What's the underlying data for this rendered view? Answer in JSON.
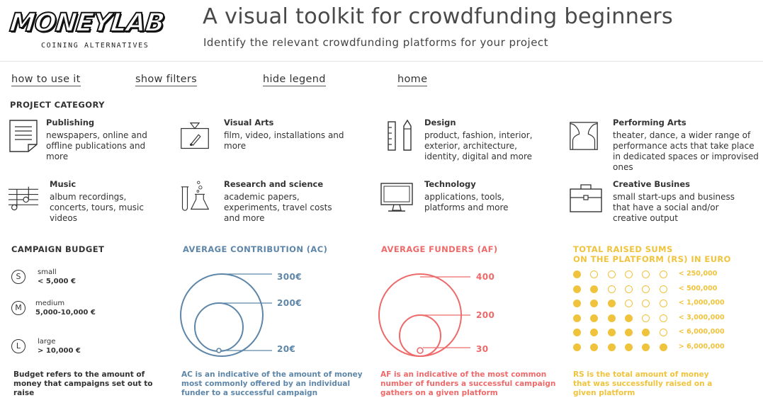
{
  "header": {
    "logo_text": "MONEYLAB",
    "logo_tagline": "COINING ALTERNATIVES",
    "title": "A visual toolkit for crowdfunding beginners",
    "subtitle": "Identify the relevant crowdfunding platforms for your project"
  },
  "nav": {
    "how_to_use": "how to use it",
    "show_filters": "show filters",
    "hide_legend": "hide legend",
    "home": "home"
  },
  "category": {
    "heading": "PROJECT CATEGORY",
    "items": [
      {
        "title": "Publishing",
        "desc": "newspapers, online and offline publications and more",
        "icon": "document-icon"
      },
      {
        "title": "Visual Arts",
        "desc": "film, video, installations and more",
        "icon": "easel-brush-icon"
      },
      {
        "title": "Design",
        "desc": "product, fashion, interior, exterior, architecture, identity, digital and more",
        "icon": "ruler-pencil-icon"
      },
      {
        "title": "Performing Arts",
        "desc": "theater, dance, a wider range of performance acts that take place in dedicated spaces or improvised ones",
        "icon": "stage-curtain-icon"
      },
      {
        "title": "Music",
        "desc": "album recordings, concerts, tours, music videos",
        "icon": "music-staff-icon"
      },
      {
        "title": "Research and science",
        "desc": "academic papers, experiments, travel costs and more",
        "icon": "flask-test-tube-icon"
      },
      {
        "title": "Technology",
        "desc": "applications, tools, platforms and more",
        "icon": "monitor-icon"
      },
      {
        "title": "Creative Busines",
        "desc": "small start-ups and business that have a social and/or creative output",
        "icon": "briefcase-icon"
      }
    ]
  },
  "budget": {
    "heading": "CAMPAIGN BUDGET",
    "items": [
      {
        "letter": "S",
        "size": "small",
        "range": "< 5,000 €"
      },
      {
        "letter": "M",
        "size": "medium",
        "range": "5,000-10,000 €"
      },
      {
        "letter": "L",
        "size": "large",
        "range": "> 10,000 €"
      }
    ],
    "note": "Budget refers to the amount of money that campaigns set out to raise"
  },
  "ac": {
    "heading": "AVERAGE CONTRIBUTION (AC)",
    "color": "#5e86a8",
    "labels": [
      "300€",
      "200€",
      "20€"
    ],
    "note": "AC is an indicative of the amount of money most commonly offered by an individual funder to a successful campaign"
  },
  "af": {
    "heading": "AVERAGE FUNDERS (AF)",
    "color": "#ee6a6a",
    "labels": [
      "400",
      "200",
      "30"
    ],
    "note": "AF is an indicative of the most common number of funders a successful campaign gathers on a given platform"
  },
  "rs": {
    "heading_line1": "TOTAL RAISED SUMS",
    "heading_line2": "ON THE PLATFORM (RS) IN EURO",
    "color": "#f0c33c",
    "rows": [
      {
        "label": "< 250,000",
        "filled": 1
      },
      {
        "label": "< 500,000",
        "filled": 2
      },
      {
        "label": "< 1,000,000",
        "filled": 3
      },
      {
        "label": "< 3,000,000",
        "filled": 4
      },
      {
        "label": "< 6,000,000",
        "filled": 5
      },
      {
        "label": "> 6,000,000",
        "filled": 6
      }
    ],
    "note": "RS is the total amount of money that was successfully raised on a given platform"
  }
}
